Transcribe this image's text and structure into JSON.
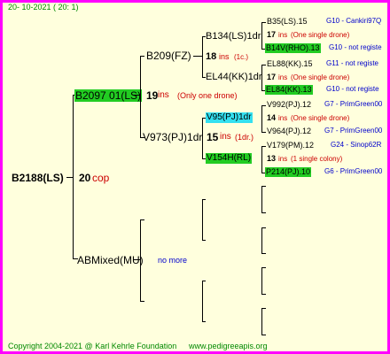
{
  "header": {
    "date": "20- 10-2021 ( 20: 1)"
  },
  "footer": {
    "copyright": "Copyright 2004-2021 @ Karl Kehrle Foundation",
    "site": "www.pedigreeapis.org"
  },
  "colors": {
    "frame": "#ff00ff",
    "background": "#ffffdd",
    "highlight_green": "#22cc22",
    "highlight_cyan": "#33e0f0",
    "ins_red": "#cc0000",
    "link_blue": "#0000cc"
  },
  "root": {
    "id": "B2188(LS)",
    "ins_num": "20",
    "ins_unit": "cop"
  },
  "gen1": {
    "upper": {
      "id": "B2097 01(LS)",
      "ins_num": "19",
      "ins_unit": "ins",
      "note": "(Only one drone)"
    },
    "lower": {
      "id": "ABMixed(MU)",
      "note": "no more"
    }
  },
  "gen2": {
    "b209": {
      "id": "B209(FZ)"
    },
    "v973": {
      "id": "V973(PJ)1dr",
      "ins_num": "15",
      "ins_unit": "ins",
      "note": "(1dr.)"
    }
  },
  "gen3": {
    "b134": {
      "id": "B134(LS)1dr",
      "ins_num": "18",
      "ins_unit": "ins",
      "note": "(1c.)"
    },
    "el44": {
      "id": "EL44(KK)1dr"
    },
    "v95": {
      "id": "V95(PJ)1dr"
    },
    "v154": {
      "id": "V154H(RL)"
    }
  },
  "gen4": [
    {
      "id": "B35(LS).15",
      "extra": "G10 - Cankiri97Q",
      "ins_num": "17",
      "ins_unit": "ins",
      "note": "(One single drone)"
    },
    {
      "id": "B14V(RHO).13",
      "extra": "G10 - not registe"
    },
    {
      "id": "EL88(KK).15",
      "extra": "G11 - not registe",
      "ins_num": "17",
      "ins_unit": "ins",
      "note": "(One single drone)"
    },
    {
      "id": "EL84(KK).13",
      "extra": "G10 - not registe"
    },
    {
      "id": "V992(PJ).12",
      "extra": "G7 - PrimGreen00",
      "ins_num": "14",
      "ins_unit": "ins",
      "note": "(One single drone)"
    },
    {
      "id": "V964(PJ).12",
      "extra": "G7 - PrimGreen00"
    },
    {
      "id": "V179(PM).12",
      "extra": "G24 - Sinop62R",
      "ins_num": "13",
      "ins_unit": "ins",
      "note": "(1 single colony)"
    },
    {
      "id": "P214(PJ).10",
      "extra": "G6 - PrimGreen00"
    }
  ]
}
